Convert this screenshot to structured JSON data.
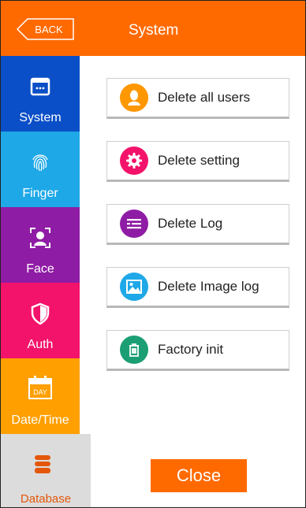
{
  "header": {
    "back_label": "BACK",
    "title": "System"
  },
  "sidebar": {
    "items": [
      {
        "label": "System",
        "color": "#0a4fc7",
        "icon": "monitor-icon"
      },
      {
        "label": "Finger",
        "color": "#1ea8e8",
        "icon": "fingerprint-icon"
      },
      {
        "label": "Face",
        "color": "#8f1ca4",
        "icon": "face-scan-icon"
      },
      {
        "label": "Auth",
        "color": "#f3136a",
        "icon": "shield-icon"
      },
      {
        "label": "Date/Time",
        "color": "#ff9f00",
        "icon": "calendar-icon",
        "icon_text": "DAY"
      },
      {
        "label": "Database",
        "active": true,
        "icon": "database-icon"
      }
    ]
  },
  "actions": [
    {
      "label": "Delete all users",
      "color": "#ff9700",
      "icon": "user-icon"
    },
    {
      "label": "Delete setting",
      "color": "#f3136a",
      "icon": "gear-icon"
    },
    {
      "label": "Delete Log",
      "color": "#8f1ca4",
      "icon": "list-icon"
    },
    {
      "label": "Delete Image log",
      "color": "#1ea8e8",
      "icon": "image-icon"
    },
    {
      "label": "Factory init",
      "color": "#1b9e74",
      "icon": "trash-icon"
    }
  ],
  "close_label": "Close",
  "colors": {
    "accent": "#ff6a00",
    "active_text": "#e4570a",
    "active_bg": "#dcdcdc"
  }
}
